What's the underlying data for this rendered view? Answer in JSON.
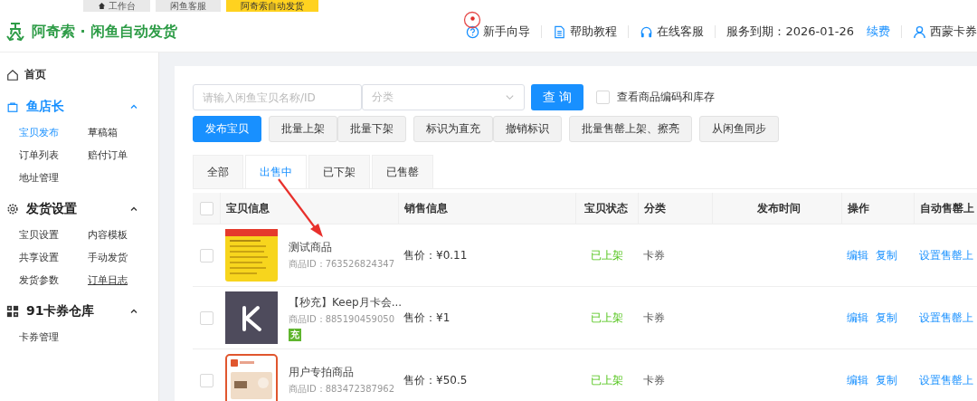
{
  "browser_tabs": [
    {
      "label": "工作台",
      "selected": false,
      "kind": "home"
    },
    {
      "label": "闲鱼客服",
      "selected": false,
      "kind": "plain"
    },
    {
      "label": "阿奇索自动发货",
      "selected": true,
      "kind": "plain"
    }
  ],
  "header": {
    "title": "阿奇索 · 闲鱼自动发货",
    "links": [
      {
        "label": "新手向导",
        "kind": "guide"
      },
      {
        "label": "帮助教程",
        "kind": "doc"
      },
      {
        "label": "在线客服",
        "kind": "headset"
      }
    ],
    "service": "服务到期：2026-01-26",
    "renew": "续费",
    "user": "西蒙卡券"
  },
  "sidebar": {
    "home": "首页",
    "groups": [
      {
        "title": "鱼店长",
        "kind": "bag",
        "expanded": true,
        "selected": true,
        "items": [
          {
            "label": "宝贝发布",
            "selected": true,
            "underlined": false
          },
          {
            "label": "草稿箱",
            "selected": false,
            "underlined": false
          },
          {
            "label": "订单列表",
            "selected": false,
            "underlined": false
          },
          {
            "label": "赔付订单",
            "selected": false,
            "underlined": false
          },
          {
            "label": "地址管理",
            "selected": false,
            "underlined": false
          }
        ]
      },
      {
        "title": "发货设置",
        "kind": "gear",
        "expanded": true,
        "selected": false,
        "items": [
          {
            "label": "宝贝设置",
            "selected": false,
            "underlined": false
          },
          {
            "label": "内容模板",
            "selected": false,
            "underlined": false
          },
          {
            "label": "共享设置",
            "selected": false,
            "underlined": false
          },
          {
            "label": "手动发货",
            "selected": false,
            "underlined": false
          },
          {
            "label": "发货参数",
            "selected": false,
            "underlined": false
          },
          {
            "label": "订单日志",
            "selected": false,
            "underlined": true
          }
        ]
      },
      {
        "title": "91卡券仓库",
        "kind": "grid",
        "expanded": true,
        "selected": false,
        "items": [
          {
            "label": "卡券管理",
            "selected": false,
            "underlined": false
          }
        ]
      }
    ]
  },
  "filters": {
    "search_placeholder": "请输入闲鱼宝贝名称/ID",
    "category_placeholder": "分类",
    "query": "查 询",
    "show_code": {
      "label": "查看商品编码和库存",
      "checked": false
    }
  },
  "actions": [
    {
      "label": "发布宝贝",
      "kind": "primary"
    },
    {
      "label": "批量上架",
      "kind": "default"
    },
    {
      "label": "批量下架",
      "kind": "default"
    },
    {
      "label": "标识为直充",
      "kind": "default"
    },
    {
      "label": "撤销标识",
      "kind": "default"
    },
    {
      "label": "批量售罄上架、擦亮",
      "kind": "default"
    },
    {
      "label": "从闲鱼同步",
      "kind": "default"
    }
  ],
  "tabs": [
    {
      "label": "全部",
      "selected": false
    },
    {
      "label": "出售中",
      "selected": true
    },
    {
      "label": "已下架",
      "selected": false
    },
    {
      "label": "已售罄",
      "selected": false
    }
  ],
  "table": {
    "select_all": false,
    "columns": [
      "宝贝信息",
      "销售信息",
      "宝贝状态",
      "分类",
      "发布时间",
      "操作",
      "自动售罄上"
    ],
    "rows": [
      {
        "checked": false,
        "title": "测试商品",
        "id": "商品ID：763526824347",
        "badge": "",
        "price": "售价：¥0.11",
        "status": "已上架",
        "category": "卡券",
        "ops": [
          "编辑",
          "复制"
        ],
        "auto": "设置售罄上"
      },
      {
        "checked": false,
        "title": "【秒充】Keep月卡会...",
        "id": "商品ID：885190459050",
        "badge": "充",
        "price": "售价：¥1",
        "status": "已上架",
        "category": "卡券",
        "ops": [
          "编辑",
          "复制"
        ],
        "auto": "设置售罄上"
      },
      {
        "checked": false,
        "title": "用户专拍商品",
        "id": "商品ID：883472387962",
        "badge": "",
        "price": "售价：¥50.5",
        "status": "已上架",
        "category": "卡券",
        "ops": [
          "编辑",
          "复制"
        ],
        "auto": "设置售罄上"
      }
    ]
  }
}
